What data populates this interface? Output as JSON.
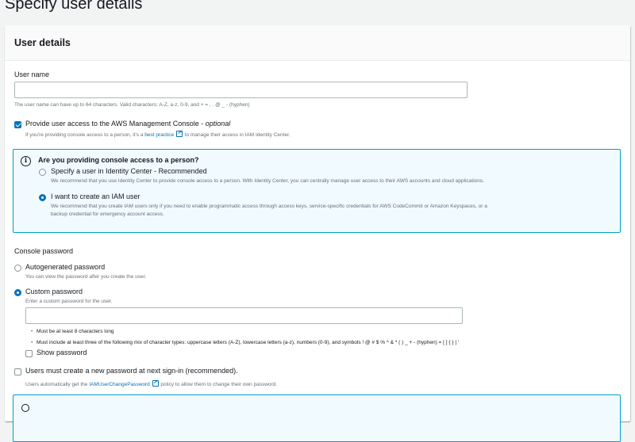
{
  "page": {
    "title": "Specify user details"
  },
  "card": {
    "title": "User details"
  },
  "user_name": {
    "label": "User name",
    "value": "",
    "hint": "The user name can have up to 64 characters. Valid characters: A-Z, a-z, 0-9, and + = , . @ _ - (hyphen)"
  },
  "console_access": {
    "label": "Provide user access to the AWS Management Console - ",
    "optional": "optional",
    "checked": true,
    "desc_prefix": "If you're providing console access to a person, it's a ",
    "desc_link": "best practice",
    "desc_suffix": " to manage their access in IAM Identity Center."
  },
  "info": {
    "title": "Are you providing console access to a person?",
    "options": [
      {
        "label": "Specify a user in Identity Center - Recommended",
        "desc": "We recommend that you use Identity Center to provide console access to a person. With Identity Center, you can centrally manage user access to their AWS accounts and cloud applications.",
        "selected": false
      },
      {
        "label": "I want to create an IAM user",
        "desc_line1": "We recommend that you create IAM users only if you need to enable programmatic access through access keys, service-specific credentials for AWS CodeCommit or Amazon Keyspaces, or a",
        "desc_line2": "backup credential for emergency account access.",
        "selected": true
      }
    ]
  },
  "console_password": {
    "label": "Console password",
    "options": [
      {
        "label": "Autogenerated password",
        "desc": "You can view the password after you create the user.",
        "selected": false
      },
      {
        "label": "Custom password",
        "desc": "Enter a custom password for the user.",
        "selected": true
      }
    ],
    "password_value": "",
    "rules": [
      "Must be at least 8 characters long",
      "Must include at least three of the following mix of character types: uppercase letters (A-Z), lowercase letters (a-z), numbers (0-9), and symbols ! @ # $ % ^ & * ( ) _ + - (hyphen) = [ ] { } | '"
    ],
    "show_password": "Show password"
  },
  "reset_required": {
    "label": "Users must create a new password at next sign-in (recommended).",
    "checked": false,
    "desc_prefix": "Users automatically get the ",
    "desc_link": "IAMUserChangePassword",
    "desc_suffix": " policy to allow them to change their own password."
  },
  "colors": {
    "accent": "#0073bb",
    "info_border": "#00a1c9",
    "info_bg": "#f1faff"
  }
}
